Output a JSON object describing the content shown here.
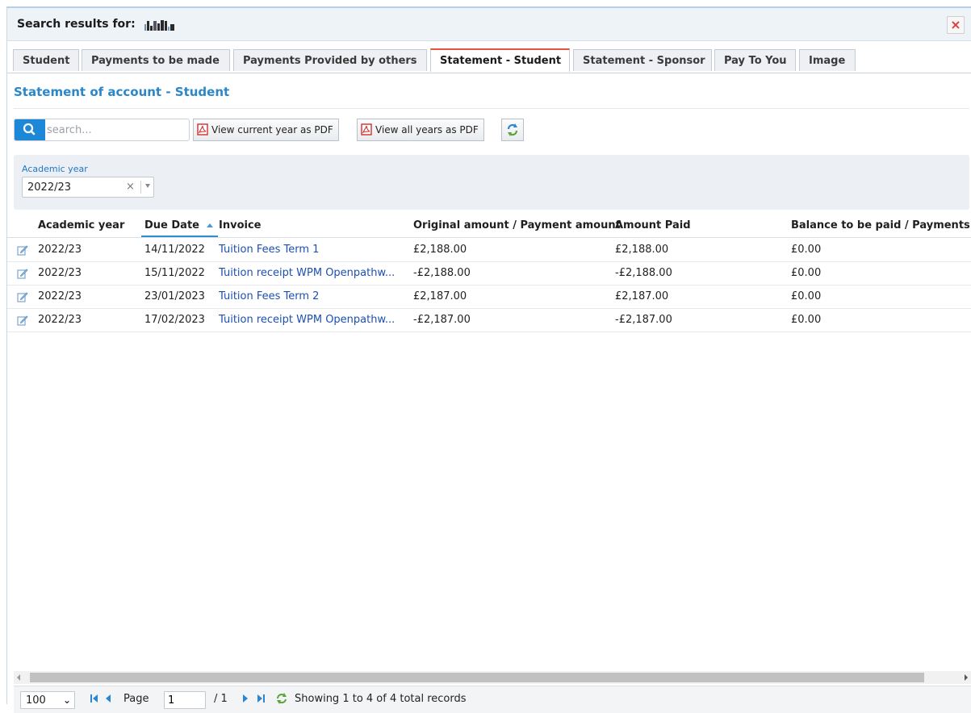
{
  "header": {
    "title": "Search results for:",
    "close_label": "×"
  },
  "tabs": [
    {
      "label": "Student",
      "active": false
    },
    {
      "label": "Payments to be made",
      "active": false
    },
    {
      "label": "Payments Provided by others",
      "active": false
    },
    {
      "label": "Statement - Student",
      "active": true
    },
    {
      "label": "Statement - Sponsor",
      "active": false
    },
    {
      "label": "Pay To You",
      "active": false
    },
    {
      "label": "Image",
      "active": false
    }
  ],
  "section_title": "Statement of account - Student",
  "toolbar": {
    "search_placeholder": "search...",
    "search_value": "",
    "pdf_current_label": "View current year as PDF",
    "pdf_all_label": "View all years as PDF"
  },
  "filter": {
    "label": "Academic year",
    "value": "2022/23",
    "clear": "×"
  },
  "table": {
    "columns": [
      "Academic year",
      "Due Date",
      "Invoice",
      "Original amount / Payment amount",
      "Amount Paid",
      "Balance to be paid / Payments m"
    ],
    "sort_column": "Due Date",
    "sort_direction": "ascending",
    "rows": [
      {
        "year": "2022/23",
        "due": "14/11/2022",
        "invoice": "Tuition Fees Term 1",
        "original": "£2,188.00",
        "paid": "£2,188.00",
        "balance": "£0.00"
      },
      {
        "year": "2022/23",
        "due": "15/11/2022",
        "invoice": "Tuition receipt WPM Openpathw...",
        "original": "-£2,188.00",
        "paid": "-£2,188.00",
        "balance": "£0.00"
      },
      {
        "year": "2022/23",
        "due": "23/01/2023",
        "invoice": "Tuition Fees Term 2",
        "original": "£2,187.00",
        "paid": "£2,187.00",
        "balance": "£0.00"
      },
      {
        "year": "2022/23",
        "due": "17/02/2023",
        "invoice": "Tuition receipt WPM Openpathw...",
        "original": "-£2,187.00",
        "paid": "-£2,187.00",
        "balance": "£0.00"
      }
    ]
  },
  "pager": {
    "page_size": "100",
    "page_label": "Page",
    "page_value": "1",
    "page_total": "/ 1",
    "status": "Showing 1 to 4 of 4 total records"
  },
  "icons": {
    "search": "search-icon",
    "pdf": "pdf-icon",
    "refresh": "refresh-icon",
    "edit": "edit-icon",
    "close": "close-icon"
  },
  "colors": {
    "accent": "#1e88d8",
    "section_title": "#2b87c8",
    "active_tab_border": "#e5533c",
    "link": "#1d4fb0",
    "close": "#e53935"
  }
}
